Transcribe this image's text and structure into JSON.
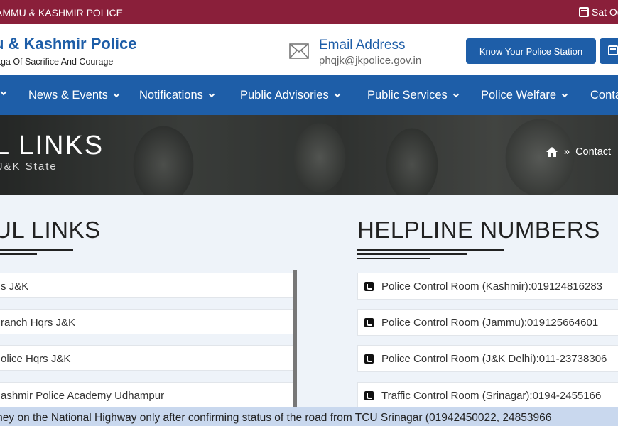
{
  "topbar": {
    "org": "AMMU & KASHMIR POLICE",
    "date": "Sat Oc"
  },
  "header": {
    "brand_title": "u & Kashmir Police",
    "brand_sub": "aga Of Sacrifice And Courage",
    "email_label": "Email Address",
    "email_value": "phqjk@jkpolice.gov.in",
    "station_button": "Know Your Police Station"
  },
  "nav": {
    "items": [
      {
        "label": "News & Events"
      },
      {
        "label": "Notifications"
      },
      {
        "label": "Public Advisories"
      },
      {
        "label": "Public Services"
      },
      {
        "label": "Police Welfare"
      },
      {
        "label": "Conta"
      }
    ]
  },
  "banner": {
    "title": "L LINKS",
    "subtitle": "J&K State",
    "breadcrumb_sep": "»",
    "breadcrumb_current": "Contact"
  },
  "useful_links": {
    "title": "UL LINKS",
    "items": [
      "s J&K",
      "ranch Hqrs J&K",
      "olice Hqrs J&K",
      "ashmir Police Academy Udhampur"
    ]
  },
  "helpline": {
    "title": "HELPLINE NUMBERS",
    "items": [
      "Police Control Room (Kashmir):019124816283",
      "Police Control Room (Jammu):019125664601",
      "Police Control Room (J&K Delhi):011-23738306",
      "Traffic Control Room (Srinagar):0194-2455166"
    ]
  },
  "ticker": {
    "text": "rney on the National Highway only after confirming status of the road from TCU Srinagar (01942450022, 24853966"
  },
  "colors": {
    "topbar": "#8a1f3a",
    "primary": "#1e5ea8",
    "ticker": "#c9d8ee",
    "page_bg": "#eef3f9"
  }
}
